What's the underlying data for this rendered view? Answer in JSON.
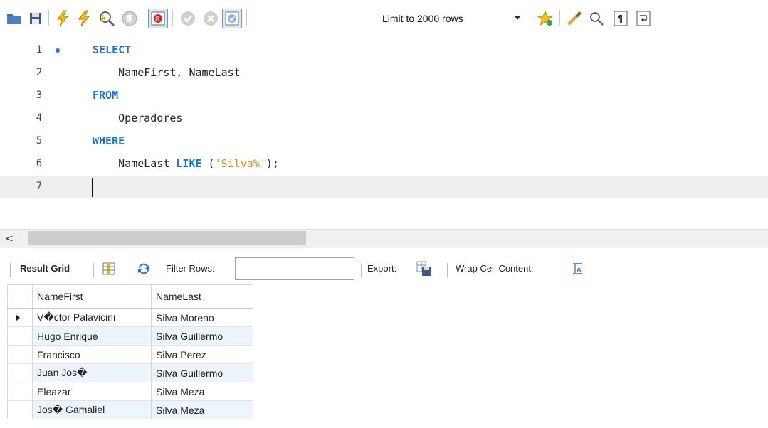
{
  "toolbar": {
    "limit_label": "Limit to 2000 rows"
  },
  "editor": {
    "lines": [
      {
        "num": "1",
        "tokens": [
          {
            "t": "SELECT",
            "k": "kw"
          }
        ]
      },
      {
        "num": "2",
        "tokens": [
          {
            "t": "    NameFirst, NameLast",
            "k": "id"
          }
        ]
      },
      {
        "num": "3",
        "tokens": [
          {
            "t": "FROM",
            "k": "kw"
          }
        ]
      },
      {
        "num": "4",
        "tokens": [
          {
            "t": "    Operadores",
            "k": "id"
          }
        ]
      },
      {
        "num": "5",
        "tokens": [
          {
            "t": "WHERE",
            "k": "kw"
          }
        ]
      },
      {
        "num": "6",
        "tokens": [
          {
            "t": "    NameLast ",
            "k": "id"
          },
          {
            "t": "LIKE",
            "k": "kw"
          },
          {
            "t": " (",
            "k": "id"
          },
          {
            "t": "'Silva%'",
            "k": "str"
          },
          {
            "t": ");",
            "k": "id"
          }
        ]
      },
      {
        "num": "7",
        "tokens": []
      }
    ]
  },
  "results_toolbar": {
    "result_grid_label": "Result Grid",
    "filter_label": "Filter Rows:",
    "filter_value": "",
    "export_label": "Export:",
    "wrap_label": "Wrap Cell Content:"
  },
  "grid": {
    "columns": [
      "NameFirst",
      "NameLast"
    ],
    "rows": [
      [
        "V�ctor Palavicini",
        "Silva Moreno"
      ],
      [
        "Hugo Enrique",
        "Silva Guillermo"
      ],
      [
        "Francisco",
        "Silva Perez"
      ],
      [
        "Juan Jos�",
        "Silva Guillermo"
      ],
      [
        "Eleazar",
        "Silva Meza"
      ],
      [
        "Jos� Gamaliel",
        "Silva Meza"
      ]
    ]
  },
  "colors": {
    "keyword": "#1d73c8",
    "string": "#e08a1e",
    "alt_row": "#eef4fb",
    "current_line": "#eeeeee"
  },
  "icons": [
    "folder-icon",
    "save-icon",
    "execute-icon",
    "execute-current-icon",
    "explain-icon",
    "stop-icon",
    "toggle-error-icon",
    "commit-icon",
    "rollback-icon",
    "autocommit-icon",
    "bookmark-icon",
    "beautify-icon",
    "find-icon",
    "invisible-chars-icon",
    "wrap-icon",
    "grid-view-icon",
    "refresh-icon",
    "export-icon",
    "wrap-cell-icon"
  ]
}
